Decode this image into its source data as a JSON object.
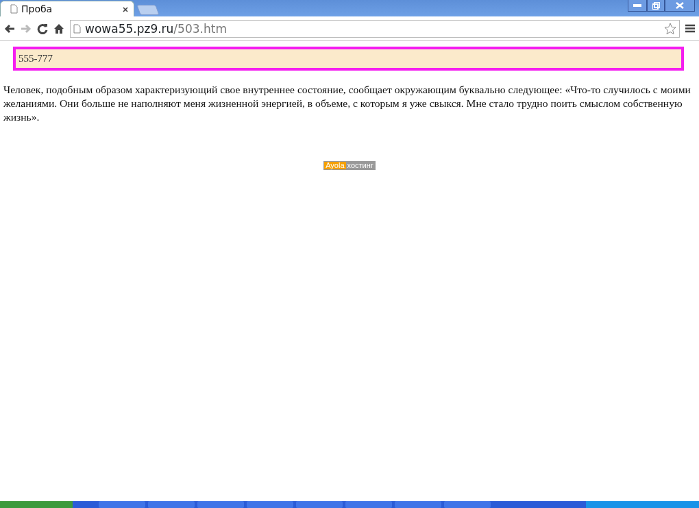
{
  "tabs": [
    {
      "label": "Проба",
      "selected": true
    }
  ],
  "address_bar": {
    "host": "wowa55.pz9.ru",
    "path": "/503.htm"
  },
  "highlight_box": {
    "text": "555-777"
  },
  "paragraph": "Человек, подобным образом характеризующий свое внутреннее состояние, сообщает окружающим буквально следующее: «Что-то случилось с моими желаниями. Они больше не наполняют меня жизненной энергией, в объеме, с которым я уже свыкся. Мне стало трудно поить смыслом собственную жизнь».",
  "hosting_badge": {
    "brand": "Ayola",
    "label": "хостинг"
  }
}
